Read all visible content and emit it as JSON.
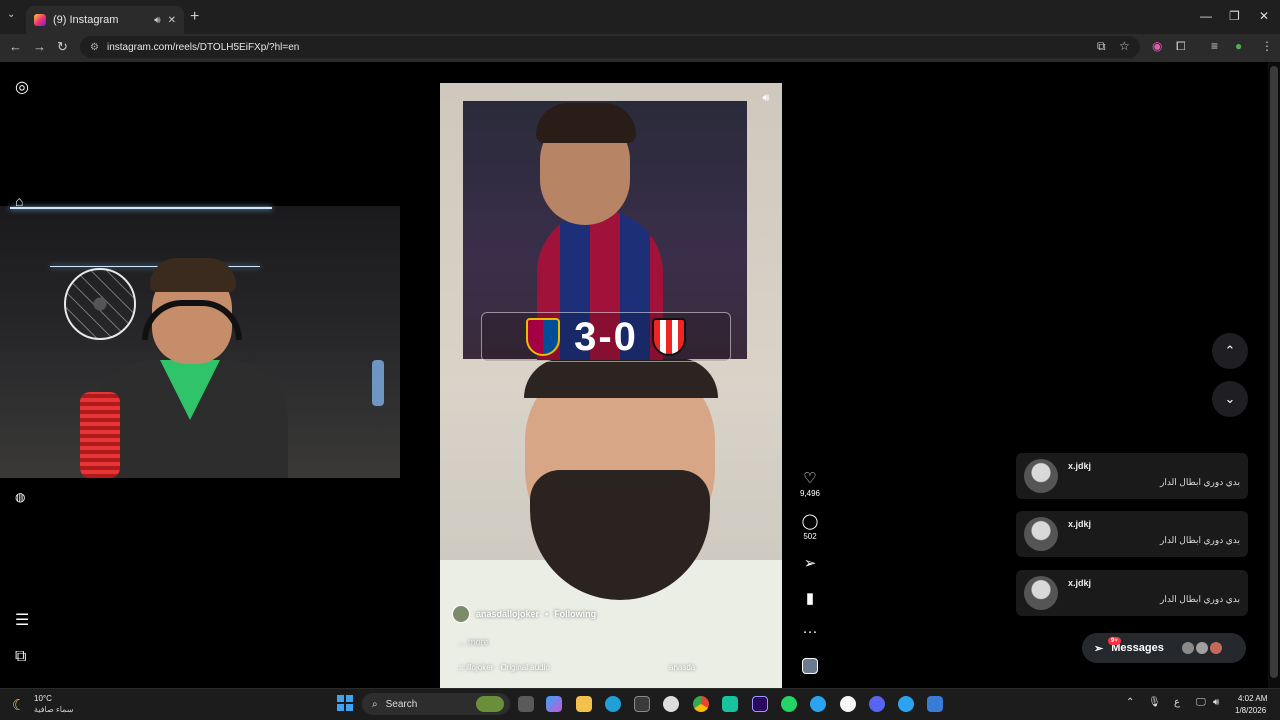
{
  "browser": {
    "tab_title": "(9) Instagram",
    "tab_audio_icon": "speaker-icon",
    "tab_close": "✕",
    "new_tab": "+",
    "url": "instagram.com/reels/DTOLH5EiFXp/?hl=en"
  },
  "reel": {
    "score": "3-0",
    "author": "anasdallojoker",
    "separator": "•",
    "follow_status": "Following",
    "caption_more": "... more",
    "audio": "♫ illojoker · Original audio",
    "audio_tag": "anasda",
    "likes": "9,496",
    "comments": "502"
  },
  "chats": [
    {
      "name": "x.jdkj",
      "message": "بدي دوري ابطال الدار"
    },
    {
      "name": "x.jdkj",
      "message": "بدي دوري ابطال الدار"
    },
    {
      "name": "x.jdkj",
      "message": "بدي دوري ابطال الدار"
    }
  ],
  "messages": {
    "label": "Messages",
    "badge": "9+"
  },
  "taskbar": {
    "temp": "10°C",
    "weather": "سماء صافية",
    "search": "Search",
    "lang": "ع",
    "time": "4:02 AM",
    "date": "1/8/2026"
  },
  "colors": {
    "accent_blue": "#3fa4f0",
    "notification_red": "#ff3040",
    "barca_blue": "#004d98",
    "barca_red": "#a50044"
  }
}
